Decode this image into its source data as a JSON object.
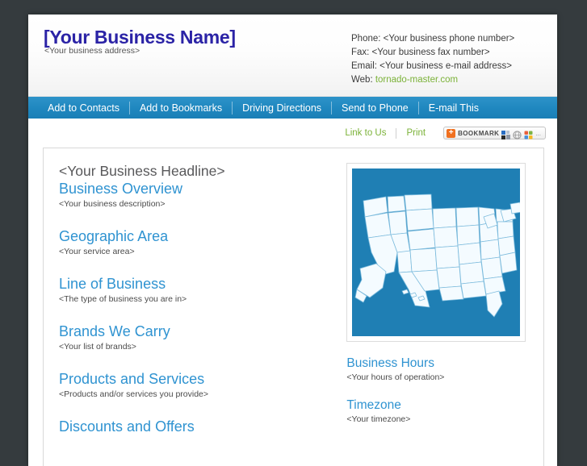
{
  "header": {
    "business_name": "[Your Business Name]",
    "business_address": "<Your business address>",
    "contact": {
      "phone": "Phone: <Your business phone number>",
      "fax": "Fax: <Your business fax number>",
      "email": "Email: <Your business e-mail address>",
      "web_label": "Web: ",
      "web_value": "tornado-master.com"
    }
  },
  "nav": {
    "items": [
      {
        "label": "Add to Contacts"
      },
      {
        "label": "Add to Bookmarks"
      },
      {
        "label": "Driving Directions"
      },
      {
        "label": "Send to Phone"
      },
      {
        "label": "E-mail This"
      }
    ]
  },
  "utility": {
    "link_to_us": "Link to Us",
    "print": "Print",
    "bookmark_label": "BOOKMARK",
    "bookmark_plus": "+",
    "bookmark_dots": "..."
  },
  "main": {
    "headline": "<Your Business Headline>",
    "sections": [
      {
        "title": "Business Overview",
        "body": "<Your business description>"
      },
      {
        "title": "Geographic Area",
        "body": "<Your service area>"
      },
      {
        "title": "Line of Business",
        "body": "<The type of business you are in>"
      },
      {
        "title": "Brands We Carry",
        "body": "<Your list of brands>"
      },
      {
        "title": "Products and Services",
        "body": "<Products and/or services you provide>"
      },
      {
        "title": "Discounts and Offers",
        "body": ""
      }
    ]
  },
  "sidebar": {
    "map_alt": "united-states-map",
    "blocks": [
      {
        "title": "Business Hours",
        "body": "<Your hours of operation>"
      },
      {
        "title": "Timezone",
        "body": "<Your timezone>"
      }
    ]
  },
  "colors": {
    "brand_blue": "#2f93d1",
    "nav_blue": "#1f87bf",
    "link_green": "#7bb238",
    "name_purple": "#2b23a6",
    "map_blue": "#1f7fb4",
    "page_bg": "#353b3e"
  }
}
